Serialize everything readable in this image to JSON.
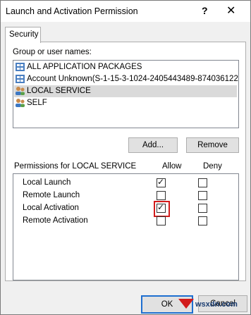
{
  "window": {
    "title": "Launch and Activation Permission",
    "help_glyph": "?",
    "close_glyph": "✕"
  },
  "tabs": [
    {
      "label": "Security"
    }
  ],
  "group": {
    "label": "Group or user names:",
    "items": [
      {
        "label": "ALL APPLICATION PACKAGES",
        "icon": "packages-icon"
      },
      {
        "label": "Account Unknown(S-1-15-3-1024-2405443489-874036122-…",
        "icon": "account-unknown-icon"
      },
      {
        "label": "LOCAL SERVICE",
        "icon": "user-group-icon",
        "selected": true
      },
      {
        "label": "SELF",
        "icon": "user-group-icon"
      }
    ],
    "add_label": "Add...",
    "remove_label": "Remove"
  },
  "permissions": {
    "label": "Permissions for LOCAL SERVICE",
    "allow_label": "Allow",
    "deny_label": "Deny",
    "rows": [
      {
        "name": "Local Launch",
        "allow": true,
        "deny": false
      },
      {
        "name": "Remote Launch",
        "allow": false,
        "deny": false
      },
      {
        "name": "Local Activation",
        "allow": true,
        "deny": false,
        "highlighted": true
      },
      {
        "name": "Remote Activation",
        "allow": false,
        "deny": false
      }
    ]
  },
  "footer": {
    "ok_label": "OK",
    "cancel_label": "Cancel"
  },
  "watermark": "wsxdn.com",
  "colors": {
    "highlight": "#d21b1b",
    "ok_border": "#1e6fd0",
    "selection": "#dadada"
  }
}
